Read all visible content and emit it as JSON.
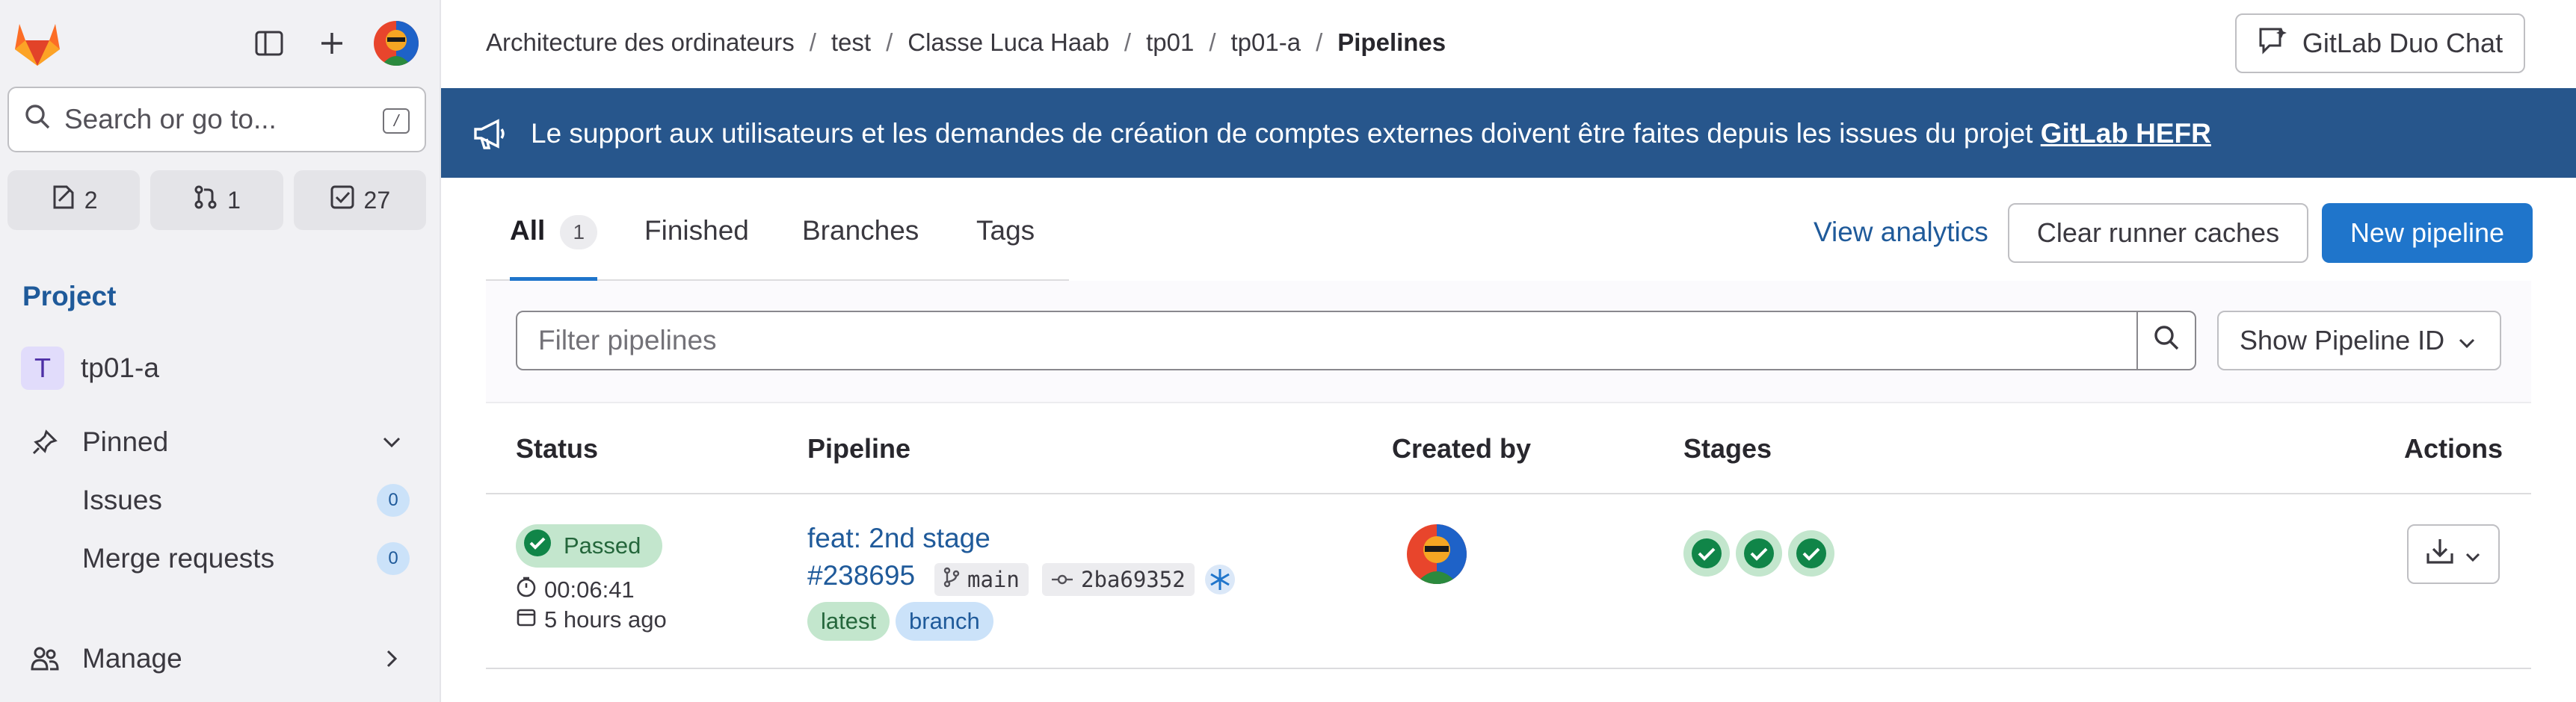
{
  "sidebar": {
    "search_placeholder": "Search or go to...",
    "search_shortcut": "/",
    "counts": {
      "issues": "2",
      "merge_requests": "1",
      "todos": "27"
    },
    "section_label": "Project",
    "project": {
      "initial": "T",
      "name": "tp01-a"
    },
    "pinned_label": "Pinned",
    "pinned_items": [
      {
        "label": "Issues",
        "count": "0"
      },
      {
        "label": "Merge requests",
        "count": "0"
      }
    ],
    "manage_label": "Manage"
  },
  "breadcrumb": {
    "items": [
      "Architecture des ordinateurs",
      "test",
      "Classe Luca Haab",
      "tp01",
      "tp01-a"
    ],
    "current": "Pipelines",
    "separator": "/"
  },
  "header": {
    "duo_label": "GitLab Duo Chat"
  },
  "banner": {
    "message": "Le support aux utilisateurs et les demandes de création de comptes externes doivent être faites depuis les issues du projet",
    "link_text": "GitLab HEFR"
  },
  "tabs": [
    {
      "label": "All",
      "count": "1"
    },
    {
      "label": "Finished"
    },
    {
      "label": "Branches"
    },
    {
      "label": "Tags"
    }
  ],
  "actions": {
    "analytics_label": "View analytics",
    "clear_caches_label": "Clear runner caches",
    "new_pipeline_label": "New pipeline"
  },
  "filter": {
    "placeholder": "Filter pipelines",
    "show_id_label": "Show Pipeline ID"
  },
  "table": {
    "headers": {
      "status": "Status",
      "pipeline": "Pipeline",
      "created_by": "Created by",
      "stages": "Stages",
      "actions": "Actions"
    },
    "rows": [
      {
        "status": "Passed",
        "duration": "00:06:41",
        "finished": "5 hours ago",
        "title": "feat: 2nd stage",
        "id": "#238695",
        "ref": "main",
        "commit": "2ba69352",
        "labels": [
          "latest",
          "branch"
        ],
        "stages_passed": 3
      }
    ]
  },
  "colors": {
    "brand_blue": "#1f75cb",
    "banner_bg": "#27568c",
    "success": "#108548",
    "link": "#1f5a9a"
  }
}
